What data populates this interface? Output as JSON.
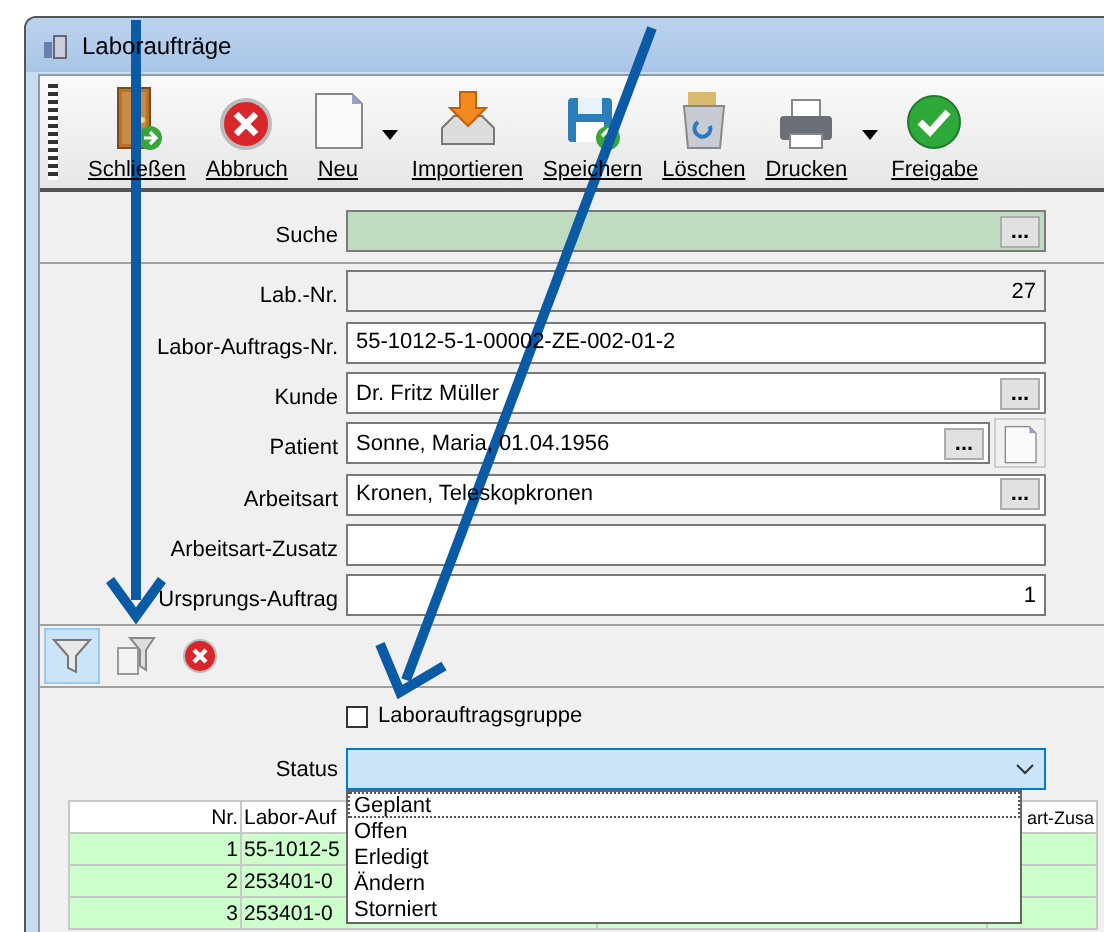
{
  "window": {
    "title": "Laboraufträge"
  },
  "toolbar": {
    "buttons": [
      {
        "label": "Schließen",
        "has_menu": false
      },
      {
        "label": "Abbruch",
        "has_menu": false
      },
      {
        "label": "Neu",
        "has_menu": true
      },
      {
        "label": "Importieren",
        "has_menu": false
      },
      {
        "label": "Speichern",
        "has_menu": false
      },
      {
        "label": "Löschen",
        "has_menu": false
      },
      {
        "label": "Drucken",
        "has_menu": true
      },
      {
        "label": "Freigabe",
        "has_menu": false
      }
    ]
  },
  "search": {
    "label": "Suche",
    "button": "..."
  },
  "fields": [
    {
      "label": "Lab.-Nr.",
      "value": "27",
      "kind": "readonly"
    },
    {
      "label": "Labor-Auftrags-Nr.",
      "value": "55-1012-5-1-00002-ZE-002-01-2",
      "kind": "text"
    },
    {
      "label": "Kunde",
      "value": "Dr. Fritz Müller",
      "kind": "lookup",
      "button": "..."
    },
    {
      "label": "Patient",
      "value": "Sonne, Maria, 01.04.1956",
      "kind": "lookup_new",
      "button": "..."
    },
    {
      "label": "Arbeitsart",
      "value": "Kronen, Teleskopkronen",
      "kind": "lookup",
      "button": "..."
    },
    {
      "label": "Arbeitsart-Zusatz",
      "kind": "text"
    },
    {
      "label": "Ursprungs-Auftrag",
      "value": "1",
      "kind": "number"
    }
  ],
  "filter_toolbar": [
    {
      "selected": true
    },
    {
      "selected": false
    },
    {
      "selected": false
    }
  ],
  "group_checkbox": {
    "label": "Laborauftragsgruppe",
    "checked": false
  },
  "status": {
    "label": "Status",
    "expanded": true,
    "options": [
      {
        "label": "Geplant",
        "selected": true
      },
      {
        "label": "Offen",
        "selected": false
      },
      {
        "label": "Erledigt",
        "selected": false
      },
      {
        "label": "Ändern",
        "selected": false
      },
      {
        "label": "Storniert",
        "selected": false
      }
    ]
  },
  "table": {
    "columns": [
      "Nr.",
      "Labor-Auf",
      "art-Zusa"
    ],
    "rows": [
      {
        "nr": "1",
        "column_2": "55-1012-5"
      },
      {
        "nr": "2",
        "column_2": "253401-0"
      },
      {
        "nr": "3",
        "column_2": "253401-0"
      }
    ]
  },
  "annotations": [
    {
      "kind": "arrow",
      "color": "#0b5aa6"
    },
    {
      "kind": "arrow",
      "color": "#0b5aa6"
    }
  ]
}
